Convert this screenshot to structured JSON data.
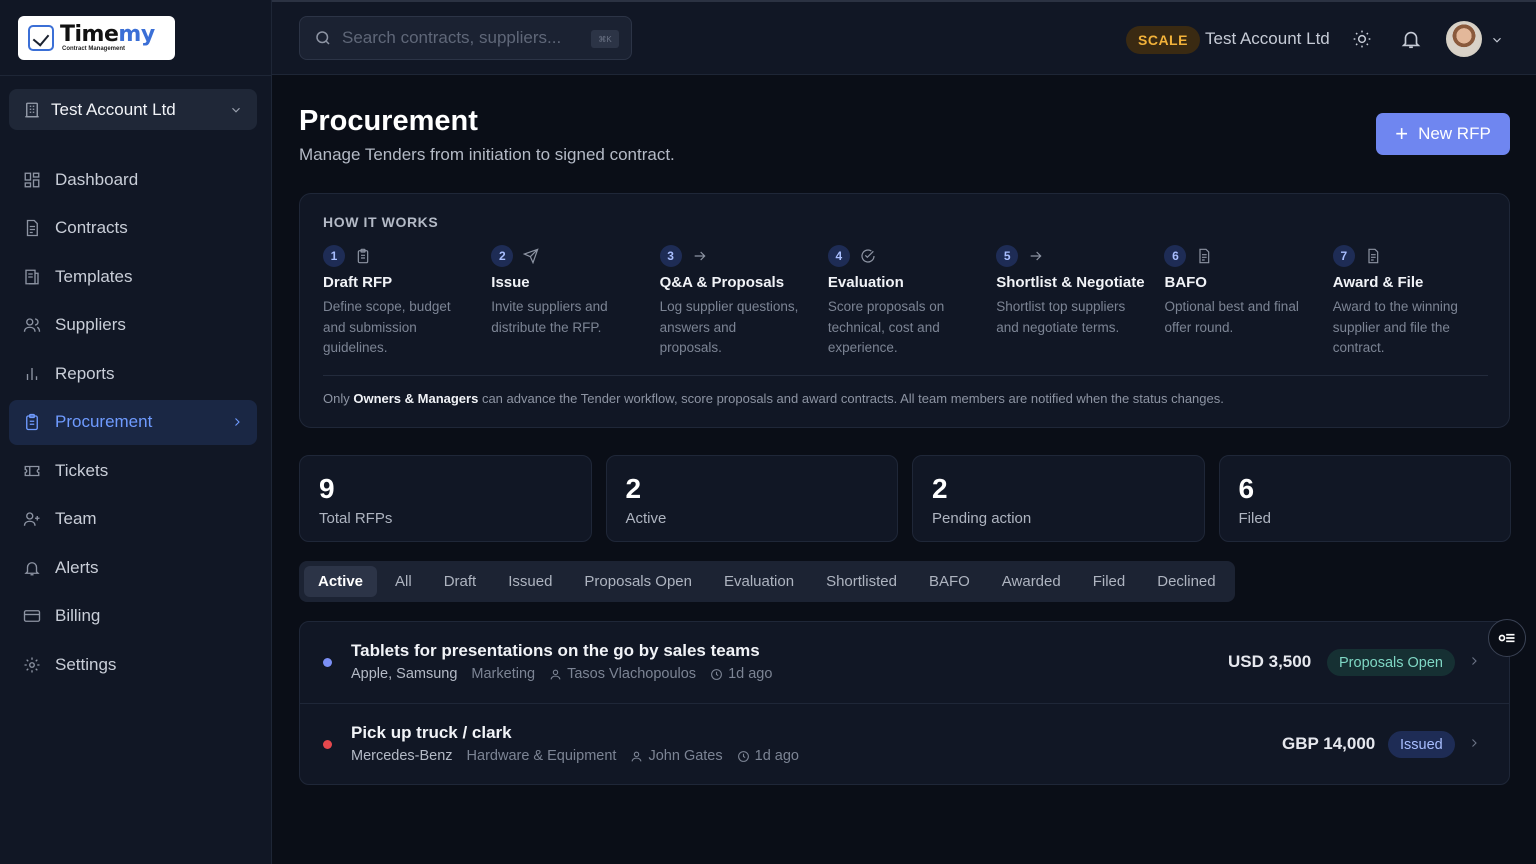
{
  "brand": {
    "logo_word_a": "Time",
    "logo_word_b": "my",
    "logo_sub": "Contract Management"
  },
  "sidebar": {
    "account": "Test Account Ltd",
    "items": [
      {
        "label": "Dashboard",
        "icon": "dashboard-icon"
      },
      {
        "label": "Contracts",
        "icon": "document-icon"
      },
      {
        "label": "Templates",
        "icon": "templates-icon"
      },
      {
        "label": "Suppliers",
        "icon": "users-icon"
      },
      {
        "label": "Reports",
        "icon": "bar-chart-icon"
      },
      {
        "label": "Procurement",
        "icon": "clipboard-icon",
        "active": true
      },
      {
        "label": "Tickets",
        "icon": "ticket-icon"
      },
      {
        "label": "Team",
        "icon": "user-plus-icon"
      },
      {
        "label": "Alerts",
        "icon": "bell-icon"
      },
      {
        "label": "Billing",
        "icon": "credit-card-icon"
      },
      {
        "label": "Settings",
        "icon": "gear-icon"
      }
    ]
  },
  "topbar": {
    "search_placeholder": "Search contracts, suppliers...",
    "search_kbd": "⌘K",
    "plan": "SCALE",
    "account": "Test Account Ltd"
  },
  "page": {
    "title": "Procurement",
    "subtitle": "Manage Tenders from initiation to signed contract.",
    "new_button": "New RFP"
  },
  "how": {
    "title": "HOW IT WORKS",
    "steps": [
      {
        "num": "1",
        "name": "Draft RFP",
        "desc": "Define scope, budget and submission guidelines.",
        "icon": "clipboard-icon"
      },
      {
        "num": "2",
        "name": "Issue",
        "desc": "Invite suppliers and distribute the RFP.",
        "icon": "send-icon"
      },
      {
        "num": "3",
        "name": "Q&A & Proposals",
        "desc": "Log supplier questions, answers and proposals.",
        "icon": "arrow-right-icon"
      },
      {
        "num": "4",
        "name": "Evaluation",
        "desc": "Score proposals on technical, cost and experience.",
        "icon": "check-circle-icon"
      },
      {
        "num": "5",
        "name": "Shortlist & Negotiate",
        "desc": "Shortlist top suppliers and negotiate terms.",
        "icon": "arrow-right-icon"
      },
      {
        "num": "6",
        "name": "BAFO",
        "desc": "Optional best and final offer round.",
        "icon": "document-icon"
      },
      {
        "num": "7",
        "name": "Award & File",
        "desc": "Award to the winning supplier and file the contract.",
        "icon": "document-icon"
      }
    ],
    "note_prefix": "Only ",
    "note_bold": "Owners & Managers",
    "note_suffix": " can advance the Tender workflow, score proposals and award contracts. All team members are notified when the status changes."
  },
  "stats": [
    {
      "value": "9",
      "label": "Total RFPs"
    },
    {
      "value": "2",
      "label": "Active"
    },
    {
      "value": "2",
      "label": "Pending action"
    },
    {
      "value": "6",
      "label": "Filed"
    }
  ],
  "tabs": [
    "Active",
    "All",
    "Draft",
    "Issued",
    "Proposals Open",
    "Evaluation",
    "Shortlisted",
    "BAFO",
    "Awarded",
    "Filed",
    "Declined"
  ],
  "rfps": [
    {
      "title": "Tablets for presentations on the go by sales teams",
      "suppliers": "Apple, Samsung",
      "category": "Marketing",
      "owner": "Tasos Vlachopoulos",
      "age": "1d ago",
      "amount": "USD 3,500",
      "status": "Proposals Open",
      "dot_color": "#7b8ff5"
    },
    {
      "title": "Pick up truck / clark",
      "suppliers": "Mercedes-Benz",
      "category": "Hardware & Equipment",
      "owner": "John Gates",
      "age": "1d ago",
      "amount": "GBP 14,000",
      "status": "Issued",
      "dot_color": "#e5484d"
    }
  ]
}
